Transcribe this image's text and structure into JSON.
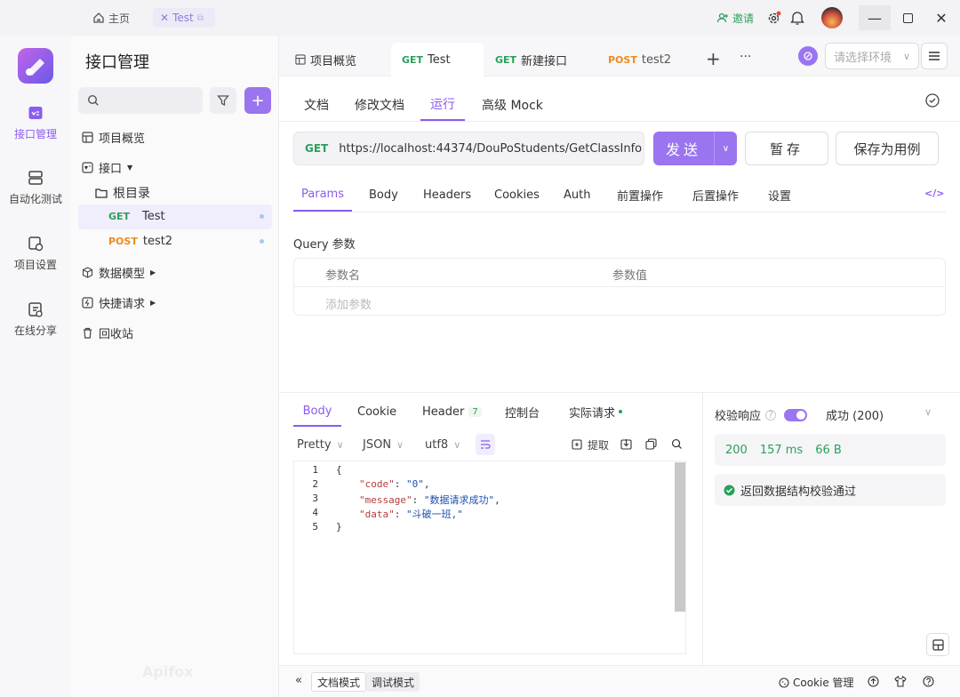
{
  "titlebar": {
    "home": "主页",
    "tab": "Test",
    "invite": "邀请"
  },
  "rail": {
    "items": [
      {
        "label": "接口管理"
      },
      {
        "label": "自动化测试"
      },
      {
        "label": "项目设置"
      },
      {
        "label": "在线分享"
      }
    ]
  },
  "sidebar": {
    "title": "接口管理",
    "tree": {
      "overview": "项目概览",
      "interface": "接口",
      "root": "根目录",
      "items": [
        {
          "method": "GET",
          "name": "Test"
        },
        {
          "method": "POST",
          "name": "test2"
        }
      ],
      "models": "数据模型",
      "quick": "快捷请求",
      "trash": "回收站"
    },
    "watermark": "Apifox"
  },
  "tabs": [
    {
      "method": "",
      "label": "项目概览"
    },
    {
      "method": "GET",
      "label": "Test"
    },
    {
      "method": "GET",
      "label": "新建接口"
    },
    {
      "method": "POST",
      "label": "test2"
    }
  ],
  "env_placeholder": "请选择环境",
  "subtabs": [
    "文档",
    "修改文档",
    "运行",
    "高级 Mock"
  ],
  "request": {
    "method": "GET",
    "url": "https://localhost:44374/DouPoStudents/GetClassInfo",
    "send": "发送",
    "save": "暂存",
    "save_case": "保存为用例"
  },
  "param_tabs": [
    "Params",
    "Body",
    "Headers",
    "Cookies",
    "Auth",
    "前置操作",
    "后置操作",
    "设置"
  ],
  "query": {
    "title": "Query 参数",
    "col_name": "参数名",
    "col_value": "参数值",
    "add": "添加参数"
  },
  "response": {
    "tabs": [
      "Body",
      "Cookie",
      "Header",
      "控制台",
      "实际请求"
    ],
    "header_count": "7",
    "format": "Pretty",
    "type": "JSON",
    "encoding": "utf8",
    "extract": "提取",
    "lines": [
      "1",
      "2",
      "3",
      "4",
      "5"
    ],
    "code": {
      "open": "{",
      "k1": "\"code\"",
      "v1": "\"0\"",
      "k2": "\"message\"",
      "v2": "\"数据请求成功\"",
      "k3": "\"data\"",
      "v3": "\"斗破一班,\"",
      "close": "}"
    },
    "validate_label": "校验响应",
    "validate_value": "成功 (200)",
    "status": "200",
    "time": "157 ms",
    "size": "66 B",
    "validation_msg": "返回数据结构校验通过"
  },
  "bottom": {
    "doc_mode": "文档模式",
    "debug_mode": "调试模式",
    "cookie": "Cookie 管理"
  },
  "colors": {
    "accent": "#9b74f0",
    "get": "#2ba05a",
    "post": "#f08a1c"
  }
}
